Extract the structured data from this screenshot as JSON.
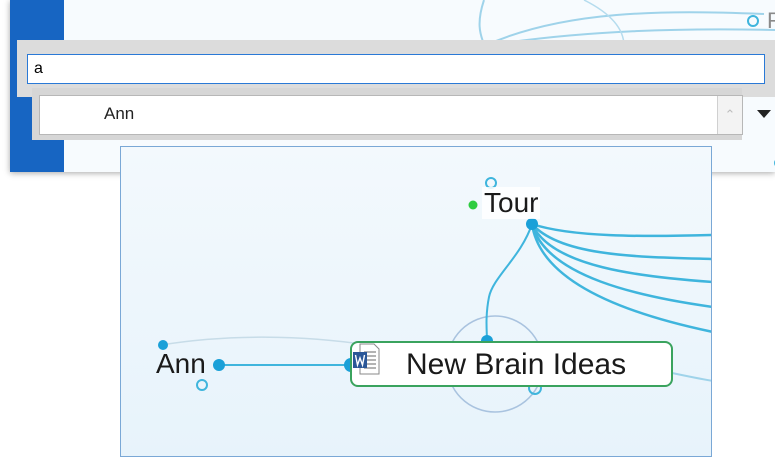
{
  "background": {
    "partial_label": "R"
  },
  "search": {
    "value": "a"
  },
  "results": {
    "items": [
      {
        "label": "Ann"
      }
    ]
  },
  "preview": {
    "thoughts": {
      "tour": "Tour",
      "ann": "Ann",
      "active": "New Brain Ideas"
    },
    "active_icon": "word-document-icon"
  },
  "colors": {
    "accent_blue": "#1765c2",
    "link_line": "#3fb5dd",
    "active_border": "#3aa35e",
    "tour_dot": "#2ecc40"
  }
}
